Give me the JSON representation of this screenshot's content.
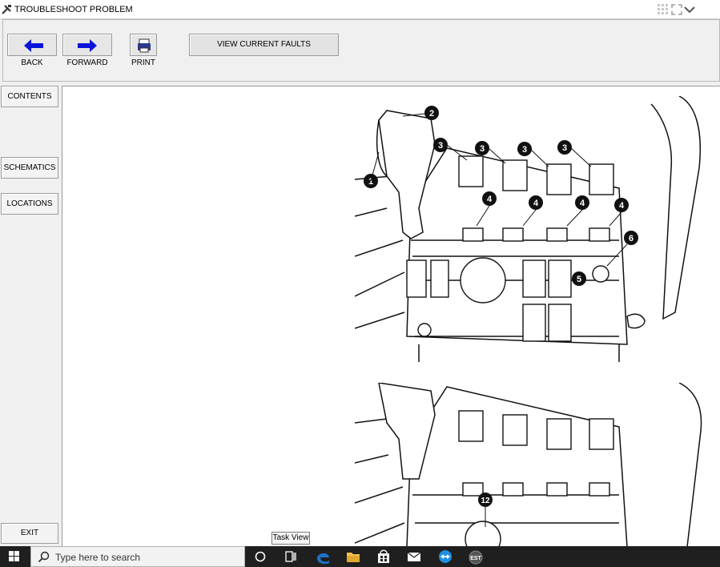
{
  "window": {
    "title": "TROUBLESHOOT PROBLEM"
  },
  "toolbar": {
    "back_label": "BACK",
    "forward_label": "FORWARD",
    "print_label": "PRINT",
    "view_faults_label": "VIEW CURRENT FAULTS"
  },
  "sidebar": {
    "contents_label": "CONTENTS",
    "schematics_label": "SCHEMATICS",
    "locations_label": "LOCATIONS",
    "exit_label": "EXIT"
  },
  "diagram_callouts_top": [
    "1",
    "2",
    "3",
    "3",
    "3",
    "3",
    "4",
    "4",
    "4",
    "4",
    "5",
    "6"
  ],
  "diagram_callouts_bottom": [
    "12"
  ],
  "tooltip": {
    "text": "Task View"
  },
  "taskbar": {
    "search_placeholder": "Type here to search",
    "apps": [
      "start-icon",
      "search-icon",
      "cortana-icon",
      "task-view-icon",
      "edge-icon",
      "file-explorer-icon",
      "store-icon",
      "mail-icon",
      "teamviewer-icon",
      "est-app-icon"
    ]
  },
  "colors": {
    "arrow_blue": "#0a14d8",
    "taskbar": "#1f1f1f",
    "edge_blue": "#1e73c8",
    "folder_yellow": "#f2c14e"
  }
}
